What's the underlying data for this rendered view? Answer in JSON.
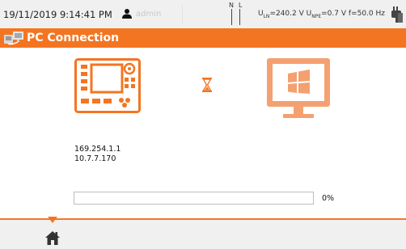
{
  "status_bar": {
    "datetime": "19/11/2019 9:14:41 PM",
    "user": "admin",
    "nl_n": "N",
    "nl_l": "L",
    "u_ln_label": "U",
    "u_ln_sub": "LN",
    "u_ln_value": "=240.2 V",
    "u_npe_label": "U",
    "u_npe_sub": "NPE",
    "u_npe_value": "=0.7 V",
    "freq": "f=50.0 Hz",
    "icons": [
      "user-icon",
      "plug-icon"
    ]
  },
  "title_bar": {
    "title": "PC Connection",
    "icon": "pc-connection-icon"
  },
  "main": {
    "icons": [
      "meter-device-icon",
      "hourglass-icon",
      "monitor-windows-icon"
    ],
    "ip_addresses": [
      "169.254.1.1",
      "10.7.7.170"
    ],
    "progress": {
      "value_fraction": 0.0,
      "label": "0%"
    }
  },
  "bottom_bar": {
    "icons": [
      "home-icon"
    ]
  },
  "colors": {
    "accent": "#f47521",
    "accent_light": "#f4a070",
    "bar_background": "#f0f0f0"
  }
}
